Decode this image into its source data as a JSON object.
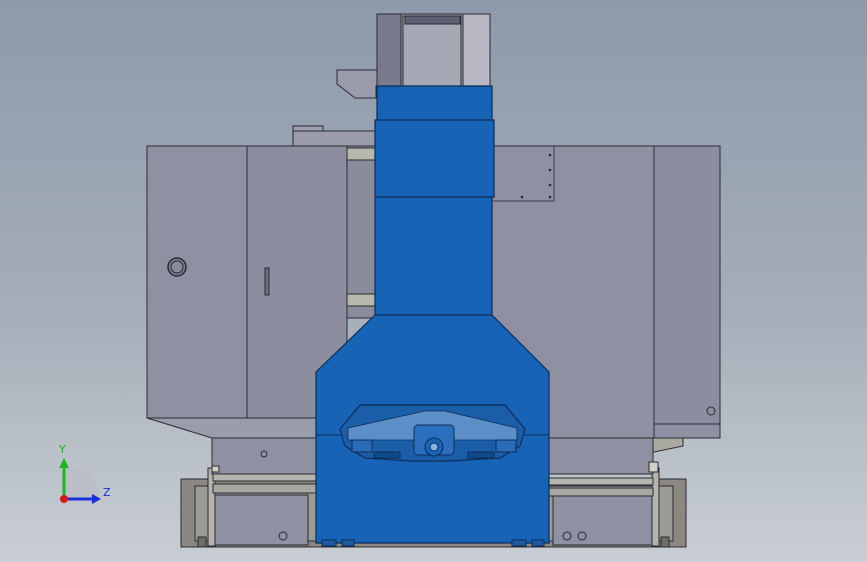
{
  "triad": {
    "y_label": "Y",
    "z_label": "Z",
    "y_color": "#1fb51f",
    "z_color": "#1a2fd6",
    "origin_color": "#d61a1a"
  },
  "colors": {
    "column_blue": "#1763b5",
    "column_edge": "#0d2d57",
    "body_gray": "#8f91a2",
    "body_gray_dark": "#7d7f90",
    "outline": "#2a2a33",
    "base_tan": "#8c8a80"
  }
}
